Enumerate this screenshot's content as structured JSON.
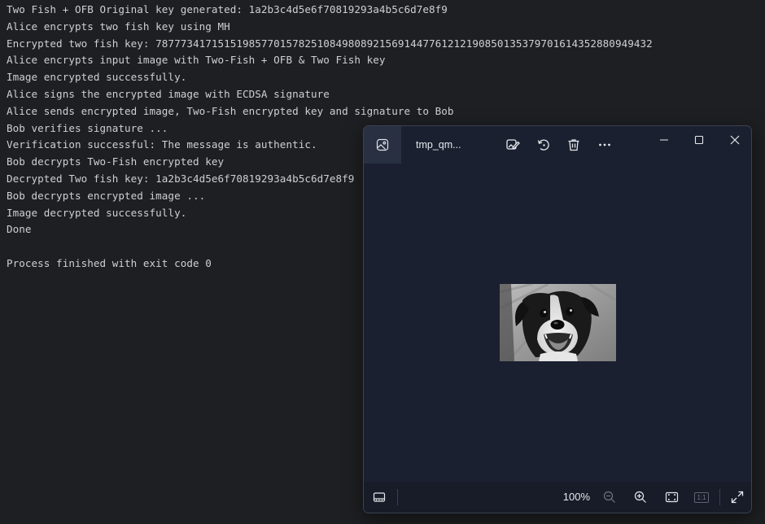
{
  "console": {
    "lines": [
      "Two Fish + OFB Original key generated: 1a2b3c4d5e6f70819293a4b5c6d7e8f9",
      "Alice encrypts two fish key using MH",
      "Encrypted two fish key: 78777341715151985770157825108498089215691447761212190850135379701614352880949432",
      "Alice encrypts input image with Two-Fish + OFB & Two Fish key",
      "Image encrypted successfully.",
      "Alice signs the encrypted image with ECDSA signature",
      "Alice sends encrypted image, Two-Fish encrypted key and signature to Bob",
      "Bob verifies signature ...",
      "Verification successful: The message is authentic.",
      "Bob decrypts Two-Fish encrypted key",
      "Decrypted Two fish key: 1a2b3c4d5e6f70819293a4b5c6d7e8f9",
      "Bob decrypts encrypted image ...",
      "Image decrypted successfully.",
      "Done",
      "",
      "Process finished with exit code 0"
    ]
  },
  "viewer": {
    "file_name": "tmp_qm...",
    "tab_icon": "image-icon",
    "toolbar": {
      "edit_icon": "edit-image-icon",
      "rotate_icon": "rotate-icon",
      "delete_icon": "trash-icon",
      "more_icon": "more-icon"
    },
    "window_controls": {
      "minimize_icon": "minimize-icon",
      "maximize_icon": "maximize-icon",
      "close_icon": "close-icon"
    },
    "photo_description_icon": "dog-photo",
    "bottom_bar": {
      "filmstrip_icon": "filmstrip-icon",
      "zoom_level": "100%",
      "zoom_out_icon": "zoom-out-icon",
      "zoom_in_icon": "zoom-in-icon",
      "fit_icon": "fit-to-window-icon",
      "actual_size_label": "1:1",
      "fullscreen_icon": "fullscreen-icon"
    }
  },
  "colors": {
    "console_bg": "#1e1f22",
    "console_text": "#cdd0d4",
    "viewer_bg": "#1b2030",
    "viewer_tab_bg": "#283041"
  }
}
